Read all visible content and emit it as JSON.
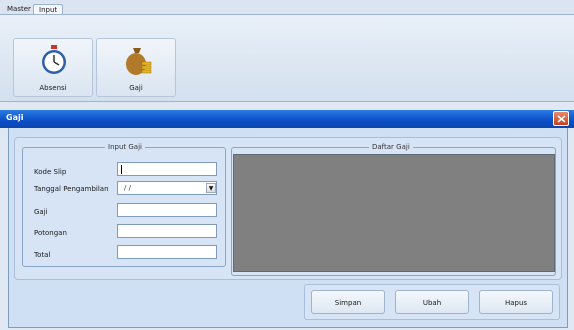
{
  "ribbon": {
    "tabs": [
      {
        "label": "Master"
      },
      {
        "label": "Input"
      }
    ],
    "buttons": [
      {
        "label": "Absensi",
        "icon": "stopwatch-icon"
      },
      {
        "label": "Gaji",
        "icon": "money-bag-icon"
      }
    ]
  },
  "form": {
    "title": "Gaji",
    "input_group": {
      "title": "Input Gaji",
      "fields": [
        {
          "label": "Kode Slip",
          "value": ""
        },
        {
          "label": "Tanggal Pengambilan",
          "value": " /  /"
        },
        {
          "label": "Gaji",
          "value": ""
        },
        {
          "label": "Potongan",
          "value": ""
        },
        {
          "label": "Total",
          "value": ""
        }
      ]
    },
    "list_group": {
      "title": "Daftar Gaji"
    },
    "buttons": {
      "save": "Simpan",
      "edit": "Ubah",
      "delete": "Hapus"
    }
  },
  "colors": {
    "titlebar": "#0a4fc4",
    "grid": "#808080",
    "ribbon": "#dbe5f1"
  }
}
